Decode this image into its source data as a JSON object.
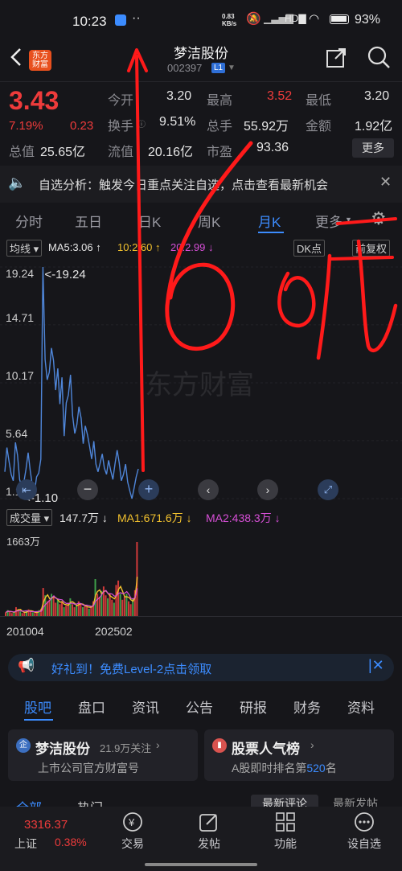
{
  "status": {
    "time": "10:23",
    "net_speed": "0.83\nKB/s",
    "battery": "93%"
  },
  "header": {
    "logo_line1": "东方",
    "logo_line2": "财富",
    "stock_name": "梦洁股份",
    "stock_code": "002397",
    "level": "L1"
  },
  "quote": {
    "price": "3.43",
    "change_pct": "7.19%",
    "change": "0.23",
    "open_label": "今开",
    "open": "3.20",
    "high_label": "最高",
    "high": "3.52",
    "low_label": "最低",
    "low": "3.20",
    "turnover_label": "换手",
    "turnover": "9.51%",
    "volume_label": "总手",
    "volume": "55.92万",
    "amount_label": "金额",
    "amount": "1.92亿",
    "mktcap_label": "总值",
    "mktcap": "25.65亿",
    "float_label": "流值",
    "float_cap": "20.16亿",
    "pe_label": "市盈",
    "pe": "93.36",
    "more_label": "更多"
  },
  "banner": {
    "text": "自选分析：触发今日重点关注自选，点击查看最新机会"
  },
  "tabs": [
    "分时",
    "五日",
    "日K",
    "周K",
    "月K",
    "更多"
  ],
  "active_tab": "月K",
  "chart_head": {
    "ma_select": "均线",
    "ma5": "MA5:3.06 ↑",
    "ma10": "10:2.60 ↑",
    "ma20": "20:2.99 ↓",
    "dk": "DK点",
    "adjust": "前复权"
  },
  "chart_data": {
    "type": "line",
    "y_ticks": [
      "19.24",
      "14.71",
      "10.17",
      "5.64",
      "1.10"
    ],
    "ylim": [
      1.1,
      19.24
    ],
    "max_label": "<-19.24",
    "min_label": "<-1.10",
    "x_ticks": [
      "201004",
      "202502"
    ],
    "series": [
      {
        "values": [
          3.2,
          5.1,
          4.0,
          3.0,
          2.5,
          5.5,
          4.5,
          2.6,
          2.0,
          2.4,
          3.4,
          4.7,
          3.3,
          2.1,
          1.6,
          2.8,
          3.1,
          4.2,
          19.24,
          12.0,
          10.4,
          11.0,
          12.9,
          11.9,
          9.6,
          11.3,
          8.5,
          10.6,
          6.0,
          8.6,
          9.2,
          10.8,
          7.6,
          6.2,
          6.9,
          8.3,
          7.4,
          5.4,
          6.8,
          6.1,
          5.2,
          4.2,
          5.6,
          3.8,
          3.2,
          3.9,
          4.6,
          3.5,
          3.0,
          4.1,
          3.3,
          2.6,
          3.8,
          4.9,
          3.9,
          2.5,
          3.0,
          3.8,
          2.4,
          1.7,
          1.1,
          1.9,
          2.8,
          3.43
        ]
      }
    ]
  },
  "volume": {
    "label": "成交量",
    "vol": "147.7万 ↓",
    "ma1": "MA1:671.6万 ↓",
    "ma2": "MA2:438.3万 ↓",
    "max": "1663万",
    "bars": [
      0.05,
      0.08,
      0.06,
      0.04,
      0.05,
      0.12,
      0.09,
      0.06,
      0.04,
      0.05,
      0.07,
      0.09,
      0.06,
      0.05,
      0.04,
      0.06,
      0.08,
      0.1,
      0.38,
      0.28,
      0.2,
      0.22,
      0.3,
      0.26,
      0.18,
      0.22,
      0.16,
      0.2,
      0.12,
      0.14,
      0.18,
      0.24,
      0.16,
      0.12,
      0.14,
      0.2,
      0.16,
      0.12,
      0.14,
      0.12,
      0.1,
      0.14,
      0.2,
      0.5,
      0.3,
      0.26,
      0.34,
      0.4,
      0.28,
      0.24,
      0.3,
      0.22,
      0.18,
      0.42,
      0.48,
      0.3,
      0.22,
      0.26,
      0.3,
      0.2,
      0.16,
      0.24,
      0.35,
      1.0
    ]
  },
  "promo": {
    "text": "好礼到！免费Level-2点击领取"
  },
  "subtabs": [
    "股吧",
    "盘口",
    "资讯",
    "公告",
    "研报",
    "财务",
    "资料"
  ],
  "cards": {
    "left_title": "梦洁股份",
    "left_follow": "21.9万关注",
    "left_sub": "上市公司官方财富号",
    "right_title": "股票人气榜",
    "right_sub_pre": "A股即时排名第",
    "right_rank": "520",
    "right_sub_post": "名"
  },
  "filters": {
    "all": "全部",
    "hot": "热门",
    "latest_comment": "最新评论",
    "latest_post": "最新发帖"
  },
  "bottombar": {
    "index_value": "3316.37",
    "index_name": "上证",
    "index_pct": "0.38%",
    "trade": "交易",
    "post": "发帖",
    "func": "功能",
    "watch": "设自选"
  },
  "annotation": {
    "text": "16元"
  }
}
